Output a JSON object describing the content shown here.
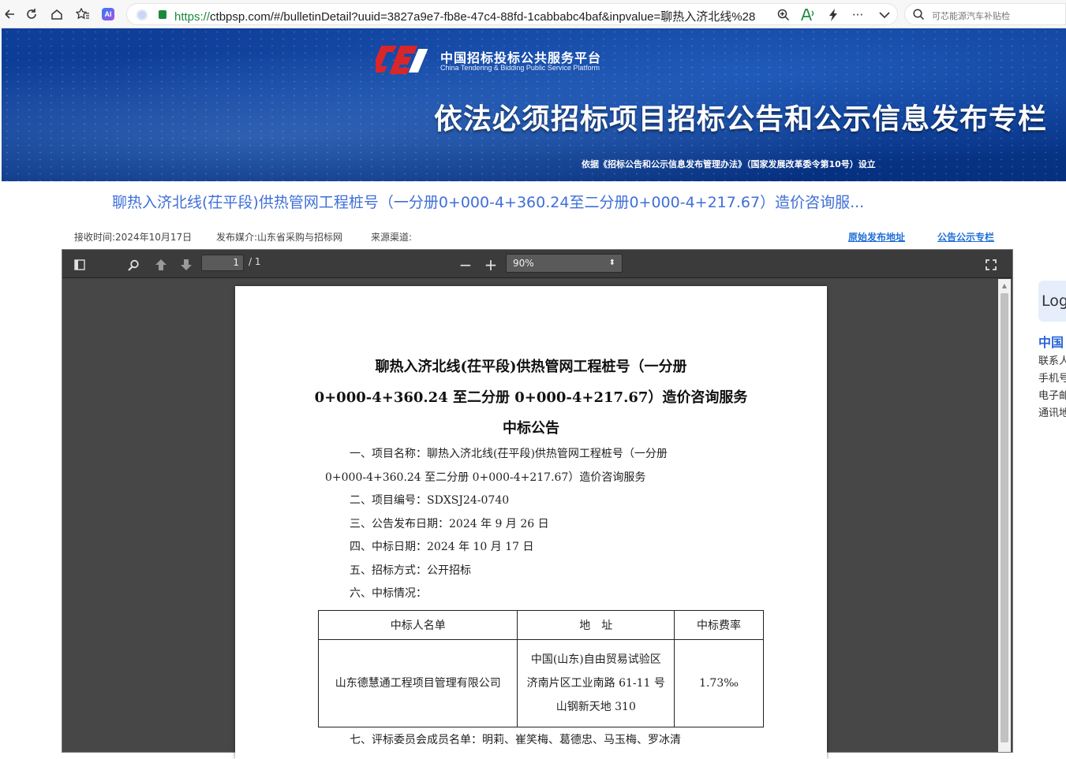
{
  "browser": {
    "url_scheme": "https://",
    "url_rest": "ctbpsp.com/#/bulletinDetail?uuid=3827a9e7-fb8e-47c4-88fd-1cabbabc4baf&inpvalue=聊热入济北线%28",
    "search_placeholder": "可芯能源汽车补贴检",
    "icons": [
      "back-icon",
      "reload-icon",
      "home-icon",
      "favorite-icon",
      "ai-icon",
      "zoom-icon",
      "read-aloud-icon",
      "bolt-icon",
      "more-icon",
      "chevron-down-icon",
      "search-icon"
    ]
  },
  "banner": {
    "logo_cn": "中国招标投标公共服务平台",
    "logo_en": "China Tendering & Bidding Public Service Platform",
    "title": "依法必须招标项目招标公告和公示信息发布专栏",
    "subtitle": "依据《招标公告和公示信息发布管理办法》（国家发展改革委令第10号）设立",
    "colors": {
      "primary": "#0a3a93",
      "logo_red": "#d9262b"
    }
  },
  "page": {
    "title": "聊热入济北线(茌平段)供热管网工程桩号（一分册0+000-4+360.24至二分册0+000-4+217.67）造价咨询服...",
    "received": "接收时间:2024年10月17日",
    "media": "发布媒介:山东省采购与招标网",
    "source": "来源渠道:",
    "link_original": "原始发布地址",
    "link_column": "公告公示专栏",
    "accent": "#3f6fd8"
  },
  "viewer": {
    "page_current": "1",
    "page_total": "/ 1",
    "zoom": "90%",
    "zoom_out": "−",
    "zoom_in": "+"
  },
  "document": {
    "title_lines": [
      "聊热入济北线(茌平段)供热管网工程桩号（一分册",
      "0+000-4+360.24 至二分册 0+000-4+217.67）造价咨询服务",
      "中标公告"
    ],
    "items": [
      "一、项目名称：聊热入济北线(茌平段)供热管网工程桩号（一分册",
      "0+000-4+360.24 至二分册 0+000-4+217.67）造价咨询服务",
      "二、项目编号：SDXSJ24-0740",
      "三、公告发布日期：2024 年 9 月 26 日",
      "四、中标日期：2024 年 10 月 17 日",
      "五、招标方式：公开招标",
      "六、中标情况："
    ],
    "table": {
      "headers": [
        "中标人名单",
        "地　址",
        "中标费率"
      ],
      "row": {
        "name": "山东德慧通工程项目管理有限公司",
        "address_lines": [
          "中国(山东)自由贸易试验区",
          "济南片区工业南路 61-11 号",
          "山钢新天地 310"
        ],
        "rate": "1.73‰"
      }
    },
    "committee": "七、评标委员会成员名单：明莉、崔笑梅、葛德忠、马玉梅、罗冰清"
  },
  "side": {
    "login": "Log",
    "org": "中国",
    "lines": [
      "联系人",
      "手机号",
      "电子邮",
      "通讯地"
    ]
  }
}
